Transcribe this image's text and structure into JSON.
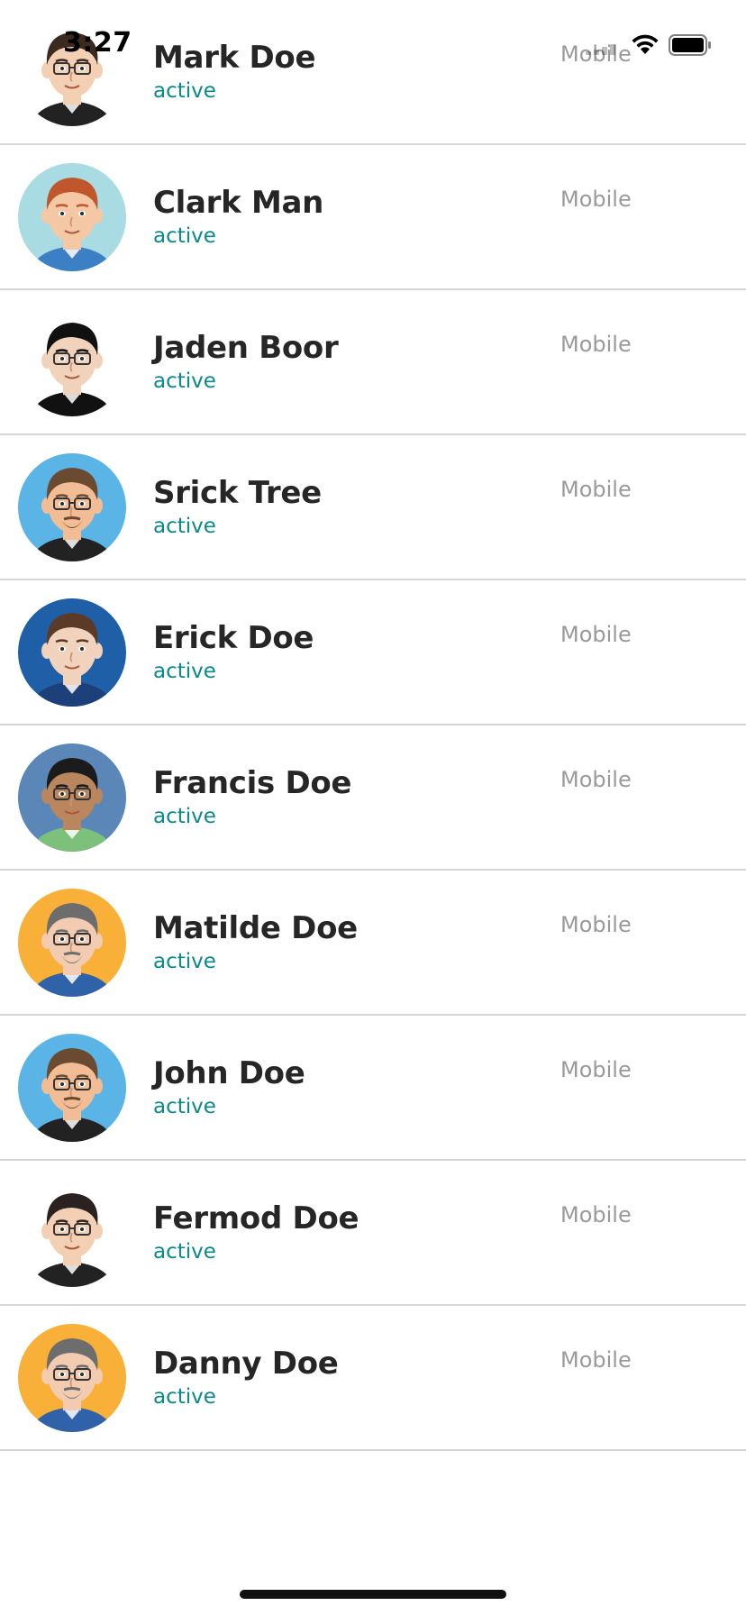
{
  "status_bar": {
    "time": "3:27"
  },
  "contacts": [
    {
      "name": "Mark Doe",
      "status": "active",
      "device": "Mobile",
      "avatar": {
        "bg": "#ffffff",
        "hair": "#3b2a20",
        "skin": "#f3cfb3",
        "shirt": "#222222",
        "glasses": true,
        "beard": false
      }
    },
    {
      "name": "Clark Man",
      "status": "active",
      "device": "Mobile",
      "avatar": {
        "bg": "#a9dbe2",
        "hair": "#c0562c",
        "skin": "#f4c8a5",
        "shirt": "#3b7fc4",
        "glasses": false,
        "beard": false
      }
    },
    {
      "name": "Jaden Boor",
      "status": "active",
      "device": "Mobile",
      "avatar": {
        "bg": "#ffffff",
        "hair": "#111111",
        "skin": "#f1d3bb",
        "shirt": "#111111",
        "glasses": true,
        "beard": false
      }
    },
    {
      "name": "Srick Tree",
      "status": "active",
      "device": "Mobile",
      "avatar": {
        "bg": "#5ab4e5",
        "hair": "#6b4a32",
        "skin": "#f2bc94",
        "shirt": "#222222",
        "glasses": true,
        "beard": true
      }
    },
    {
      "name": "Erick Doe",
      "status": "active",
      "device": "Mobile",
      "avatar": {
        "bg": "#1f5fa8",
        "hair": "#5b3b28",
        "skin": "#f1d2bd",
        "shirt": "#1d3f7a",
        "glasses": false,
        "beard": false
      }
    },
    {
      "name": "Francis Doe",
      "status": "active",
      "device": "Mobile",
      "avatar": {
        "bg": "#5a86b8",
        "hair": "#1b1b1b",
        "skin": "#b9865e",
        "shirt": "#7cc07c",
        "glasses": true,
        "beard": false
      }
    },
    {
      "name": "Matilde Doe",
      "status": "active",
      "device": "Mobile",
      "avatar": {
        "bg": "#f8b038",
        "hair": "#6d6d6d",
        "skin": "#f2cbb0",
        "shirt": "#2f62a8",
        "glasses": true,
        "beard": true
      }
    },
    {
      "name": "John Doe",
      "status": "active",
      "device": "Mobile",
      "avatar": {
        "bg": "#5ab4e5",
        "hair": "#6b4a32",
        "skin": "#f2bc94",
        "shirt": "#222222",
        "glasses": true,
        "beard": true
      }
    },
    {
      "name": "Fermod Doe",
      "status": "active",
      "device": "Mobile",
      "avatar": {
        "bg": "#ffffff",
        "hair": "#2a2220",
        "skin": "#f3cfb3",
        "shirt": "#222222",
        "glasses": true,
        "beard": false
      }
    },
    {
      "name": "Danny Doe",
      "status": "active",
      "device": "Mobile",
      "avatar": {
        "bg": "#f8b038",
        "hair": "#6d6d6d",
        "skin": "#f2cbb0",
        "shirt": "#2f62a8",
        "glasses": true,
        "beard": true
      }
    }
  ]
}
